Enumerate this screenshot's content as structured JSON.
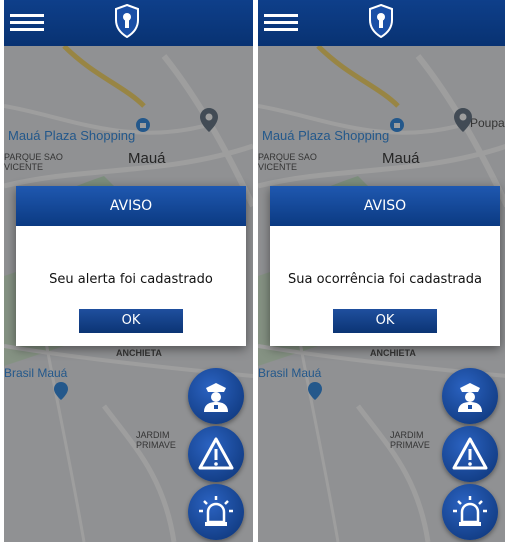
{
  "screens": [
    {
      "dialog": {
        "title": "AVISO",
        "message": "Seu alerta foi cadastrado",
        "ok_label": "OK"
      }
    },
    {
      "dialog": {
        "title": "AVISO",
        "message": "Sua ocorrência foi cadastrada",
        "ok_label": "OK"
      }
    }
  ],
  "map": {
    "shopping": "Mauá Plaza Shopping",
    "city": "Mauá",
    "neighborhood_1": "PARQUE SAO VICENTE",
    "neighborhood_2": "ANCHIETA",
    "store": "Brasil Mauá",
    "neighborhood_3": "JARDIM PRIMAVE",
    "poi": "Poupa"
  },
  "colors": {
    "primary": "#0b3a82",
    "header": "#083272"
  },
  "icons": [
    "menu-icon",
    "shield-logo-icon",
    "police-officer-icon",
    "warning-icon",
    "siren-icon"
  ]
}
